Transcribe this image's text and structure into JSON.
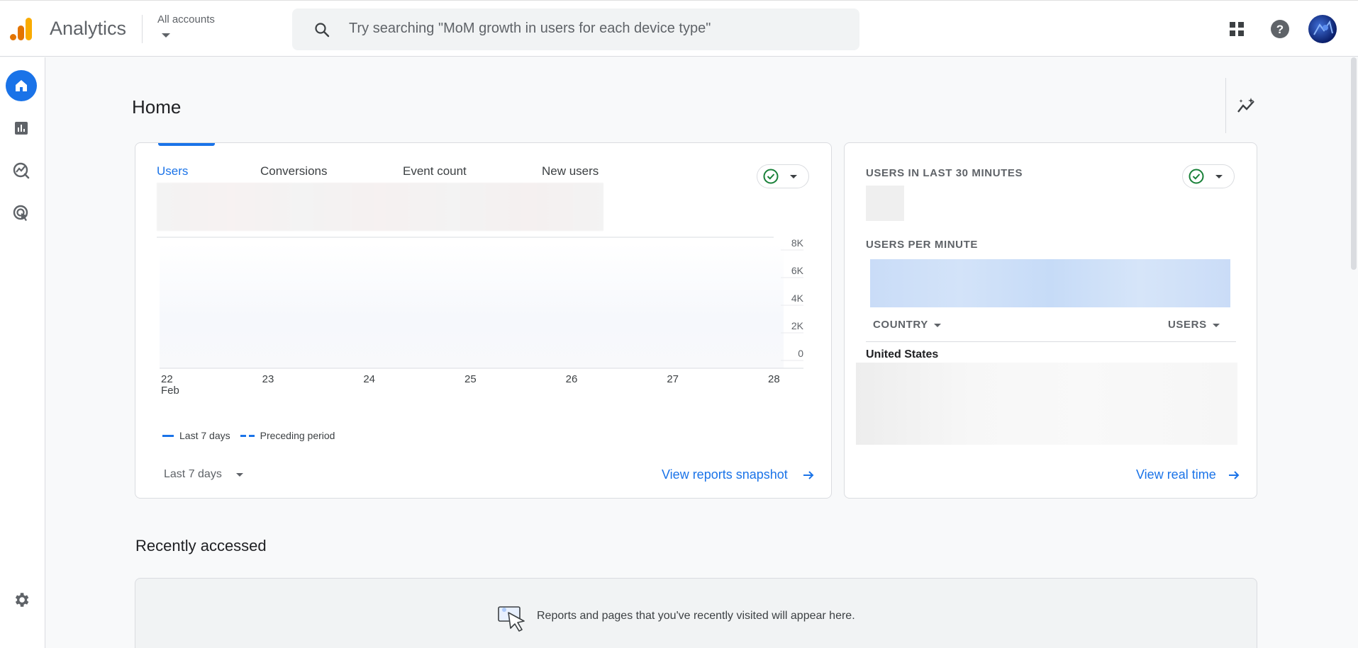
{
  "header": {
    "app_title": "Analytics",
    "accounts_label": "All accounts",
    "search_placeholder": "Try searching \"MoM growth in users for each device type\""
  },
  "nav": {
    "items": [
      "Home",
      "Reports",
      "Explore",
      "Advertising"
    ],
    "active": "Home",
    "settings": "Admin"
  },
  "page": {
    "title": "Home"
  },
  "overview_card": {
    "tabs": [
      {
        "label": "Users",
        "active": true
      },
      {
        "label": "Conversions",
        "active": false
      },
      {
        "label": "Event count",
        "active": false
      },
      {
        "label": "New users",
        "active": false
      }
    ],
    "legend": {
      "current": "Last 7 days",
      "previous": "Preceding period"
    },
    "date_range": "Last 7 days",
    "link": "View reports snapshot"
  },
  "chart_data": {
    "type": "line",
    "x": [
      "22",
      "23",
      "24",
      "25",
      "26",
      "27",
      "28"
    ],
    "x_month_label": "Feb",
    "y_ticks": [
      "8K",
      "6K",
      "4K",
      "2K",
      "0"
    ],
    "series": []
  },
  "realtime_card": {
    "users_30min_label": "USERS IN LAST 30 MINUTES",
    "per_minute_label": "USERS PER MINUTE",
    "col_country": "COUNTRY",
    "col_users": "USERS",
    "first_country": "United States",
    "link": "View real time"
  },
  "recent": {
    "title": "Recently accessed",
    "empty_message": "Reports and pages that you've recently visited will appear here."
  },
  "colors": {
    "accent": "#1a73e8",
    "check": "#188038",
    "logo_orange": "#f9ab00",
    "logo_dark": "#e37400"
  }
}
